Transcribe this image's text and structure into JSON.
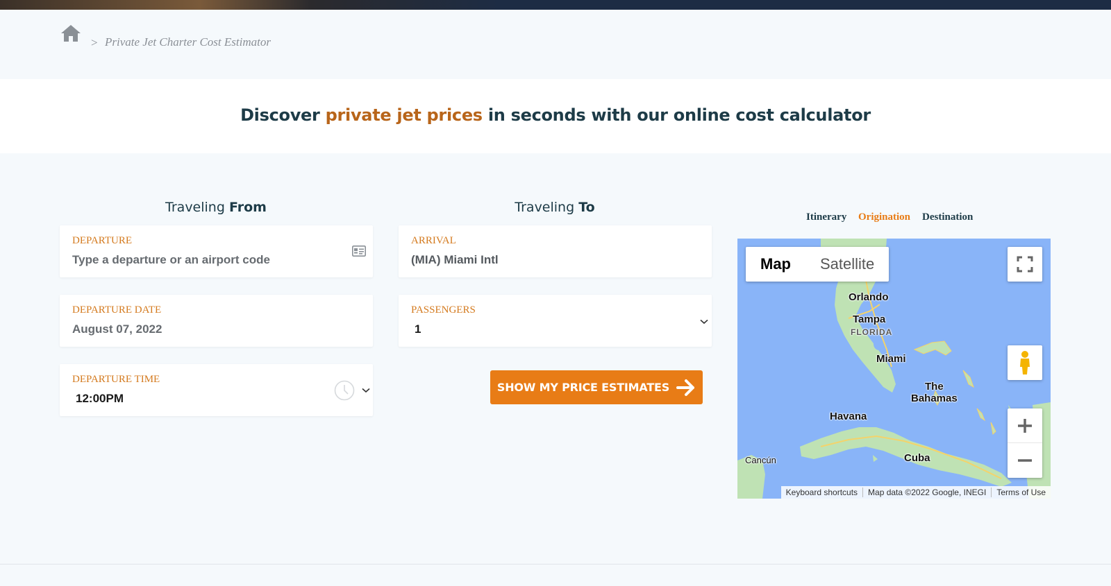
{
  "breadcrumb": {
    "separator": ">",
    "current": "Private Jet Charter Cost Estimator"
  },
  "headline": {
    "before": "Discover ",
    "accent": "private jet prices",
    "after": " in seconds with our online cost calculator"
  },
  "from": {
    "title_pre": "Traveling ",
    "title_bold": "From",
    "departure": {
      "label": "DEPARTURE",
      "placeholder": "Type a departure or an airport code",
      "value": ""
    },
    "date": {
      "label": "DEPARTURE DATE",
      "value": "August 07, 2022"
    },
    "time": {
      "label": "DEPARTURE TIME",
      "value": "12:00PM"
    }
  },
  "to": {
    "title_pre": "Traveling ",
    "title_bold": "To",
    "arrival": {
      "label": "ARRIVAL",
      "value": "(MIA) Miami Intl"
    },
    "passengers": {
      "label": "PASSENGERS",
      "value": "1"
    }
  },
  "cta": {
    "label": "SHOW MY PRICE ESTIMATES"
  },
  "map_tabs": [
    {
      "label": "Itinerary",
      "active": false
    },
    {
      "label": "Origination",
      "active": true
    },
    {
      "label": "Destination",
      "active": false
    }
  ],
  "map": {
    "type_map": "Map",
    "type_satellite": "Satellite",
    "places": {
      "orlando": "Orlando",
      "tampa": "Tampa",
      "florida": "FLORIDA",
      "miami": "Miami",
      "bahamas": "The\nBahamas",
      "havana": "Havana",
      "cuba": "Cuba",
      "cancun": "Cancún"
    },
    "attribution": {
      "shortcuts": "Keyboard shortcuts",
      "data": "Map data ©2022 Google, INEGI",
      "terms": "Terms of Use"
    },
    "colors": {
      "water": "#89b4f8",
      "land": "#bfe2b4",
      "road": "#f4d36b"
    }
  },
  "colors": {
    "accent": "#e87c16",
    "heading": "#1d3b47",
    "headline_accent": "#b8651a"
  }
}
